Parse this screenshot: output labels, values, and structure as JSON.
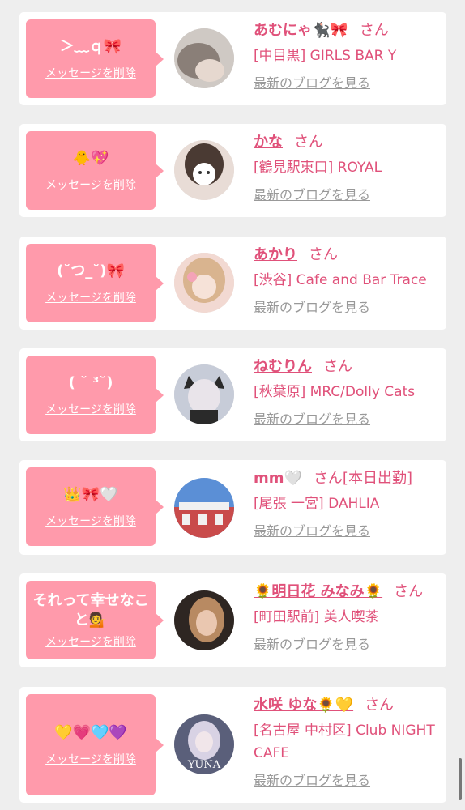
{
  "cards": [
    {
      "message": "＞﹏ｑ🎀",
      "delete_label": "メッセージを削除",
      "name": "あむにゃ🐈‍⬛🎀",
      "suffix": "さん",
      "shop": "[中目黒] GIRLS BAR Y",
      "blog_label": "最新のブログを見る",
      "avatar_tone": "#cfc9c4"
    },
    {
      "message": "🐥💖",
      "delete_label": "メッセージを削除",
      "name": "かな",
      "suffix": "さん",
      "shop": "[鶴見駅東口] ROYAL",
      "blog_label": "最新のブログを見る",
      "avatar_tone": "#e8dcd6"
    },
    {
      "message": "(˘つ_˘)🎀",
      "delete_label": "メッセージを削除",
      "name": "あかり",
      "suffix": "さん",
      "shop": "[渋谷] Cafe and Bar Trace",
      "blog_label": "最新のブログを見る",
      "avatar_tone": "#f2d9d2"
    },
    {
      "message": "( ˘ ³˘)",
      "delete_label": "メッセージを削除",
      "name": "ねむりん",
      "suffix": "さん",
      "shop": "[秋葉原] MRC/Dolly Cats",
      "blog_label": "最新のブログを見る",
      "avatar_tone": "#c7ccd8"
    },
    {
      "message": "👑🎀🤍",
      "delete_label": "メッセージを削除",
      "name": "mm🤍",
      "suffix": "さん[本日出勤]",
      "shop": "[尾張 一宮] DAHLIA",
      "blog_label": "最新のブログを見る",
      "avatar_tone": "#c94b4b"
    },
    {
      "message": "それって幸せなこと💁",
      "delete_label": "メッセージを削除",
      "name": "🌻明日花 みなみ🌻",
      "suffix": "さん",
      "shop": "[町田駅前] 美人喫茶",
      "blog_label": "最新のブログを見る",
      "avatar_tone": "#7a5a44"
    },
    {
      "message": "💛💗🩵💜",
      "delete_label": "メッセージを削除",
      "name": "水咲 ゆな🌻💛",
      "suffix": "さん",
      "shop": "[名古屋 中村区] Club NIGHT CAFE",
      "blog_label": "最新のブログを見る",
      "avatar_tone": "#5a5f7a",
      "avatar_caption": "YUNA"
    }
  ],
  "colors": {
    "accent": "#e0517a",
    "bubble": "#ff9aab",
    "link_gray": "#999999",
    "background": "#eeeeee"
  }
}
